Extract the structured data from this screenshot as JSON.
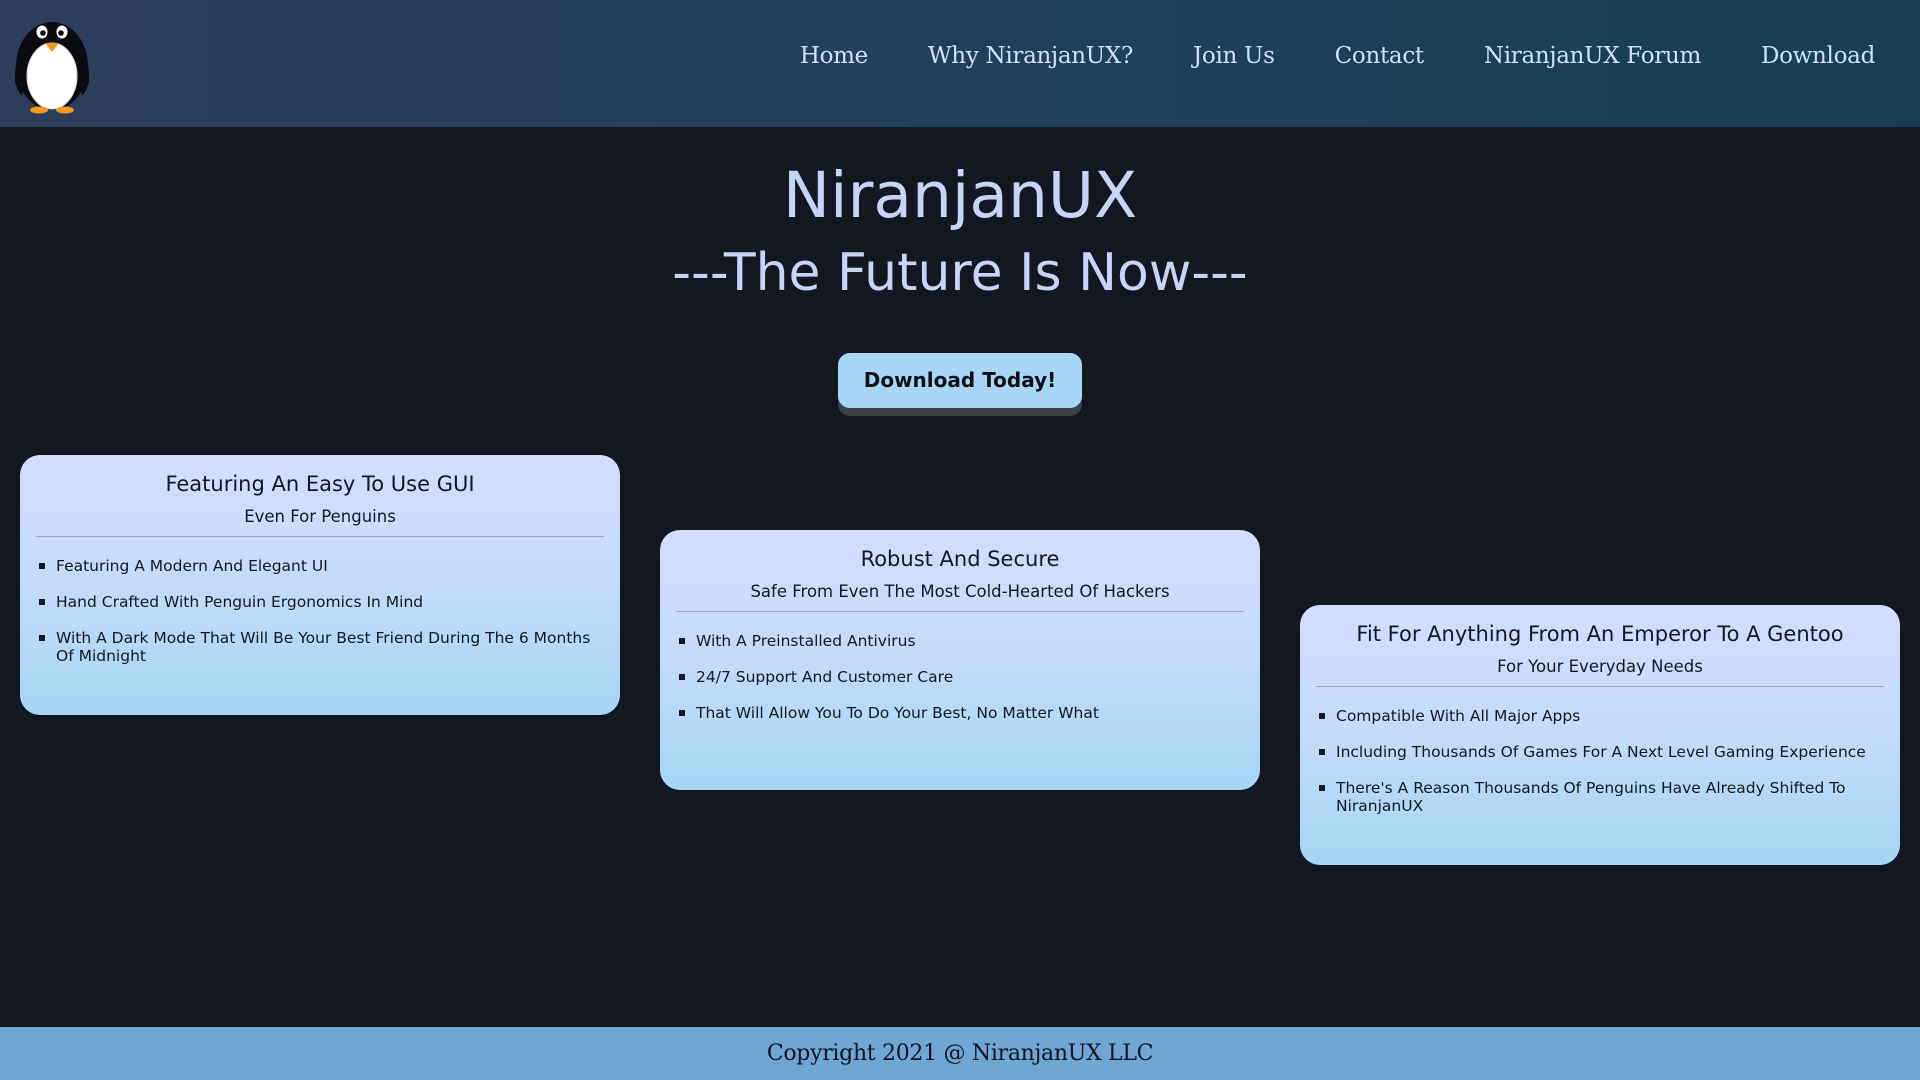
{
  "nav": {
    "logo_icon": "penguin-logo-icon",
    "links": [
      "Home",
      "Why NiranjanUX?",
      "Join Us",
      "Contact",
      "NiranjanUX Forum",
      "Download"
    ]
  },
  "hero": {
    "title": "NiranjanUX",
    "tagline": "---The Future Is Now---",
    "cta_label": "Download Today!"
  },
  "cards": [
    {
      "title": "Featuring An Easy To Use GUI",
      "subtitle": "Even For Penguins",
      "items": [
        "Featuring A Modern And Elegant UI",
        "Hand Crafted With Penguin Ergonomics In Mind",
        "With A Dark Mode That Will Be Your Best Friend During The 6 Months Of Midnight"
      ]
    },
    {
      "title": "Robust And Secure",
      "subtitle": "Safe From Even The Most Cold-Hearted Of Hackers",
      "items": [
        "With A Preinstalled Antivirus",
        "24/7 Support And Customer Care",
        "That Will Allow You To Do Your Best, No Matter What"
      ]
    },
    {
      "title": "Fit For Anything From An Emperor To A Gentoo",
      "subtitle": "For Your Everyday Needs",
      "items": [
        "Compatible With All Major Apps",
        "Including Thousands Of Games For A Next Level Gaming Experience",
        "There's A Reason Thousands Of Penguins Have Already Shifted To NiranjanUX"
      ]
    }
  ],
  "footer": {
    "copyright": "Copyright 2021 @ NiranjanUX LLC"
  },
  "colors": {
    "page_background": "#131720",
    "hero_text": "#c7d4f6",
    "button": "#a6d7f5",
    "footer": "#6fa6d3"
  }
}
